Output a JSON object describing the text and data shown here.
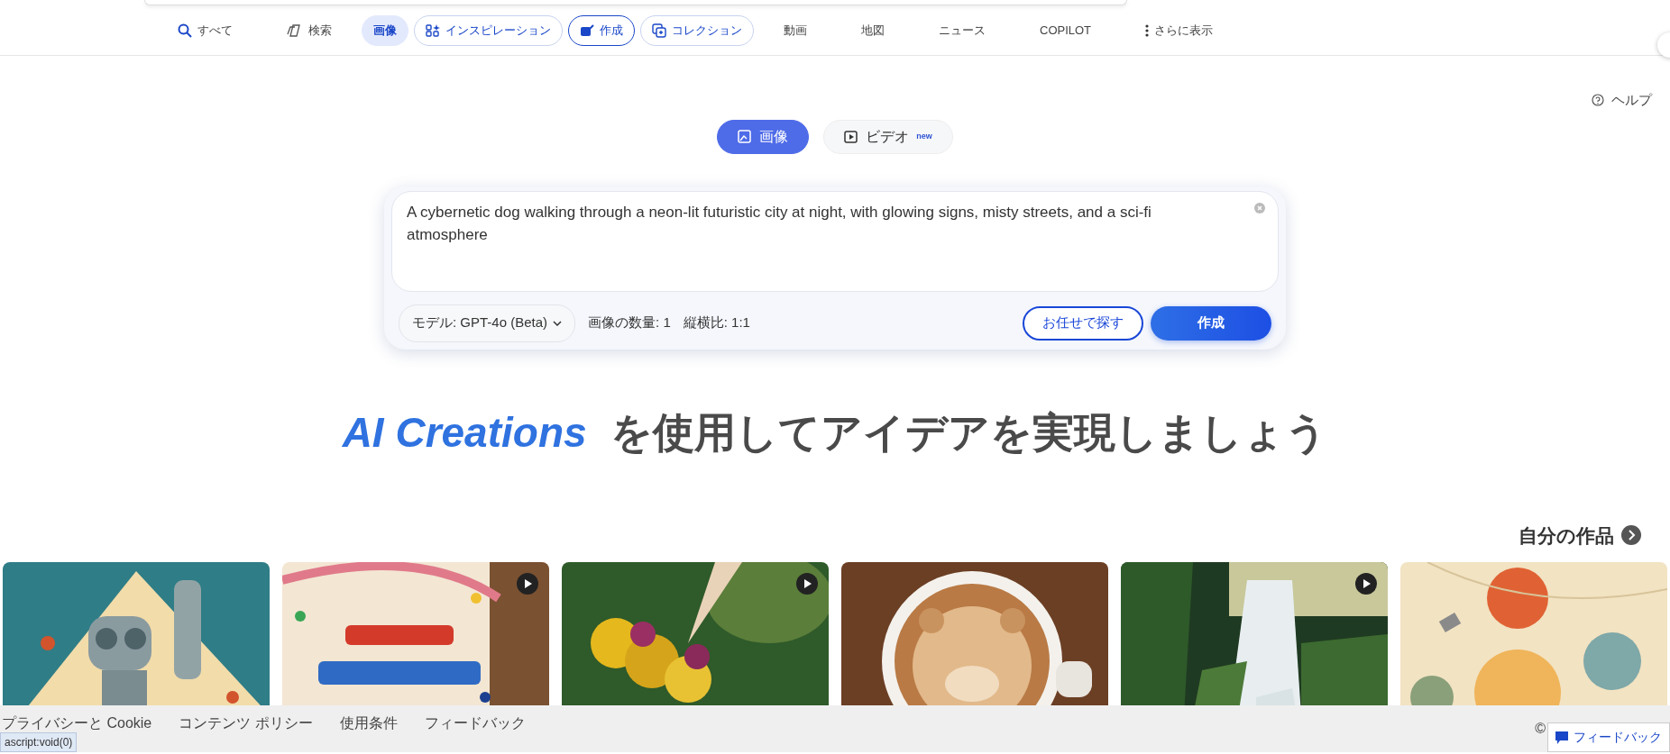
{
  "nav": {
    "tabs": [
      {
        "label": "すべて",
        "kind": "plain",
        "selected": false
      },
      {
        "label": "検索",
        "kind": "plain",
        "selected": false
      },
      {
        "label": "画像",
        "kind": "plain",
        "selected": true
      },
      {
        "label": "インスピレーション",
        "kind": "outlined",
        "selected": false
      },
      {
        "label": "作成",
        "kind": "outlined-strong",
        "selected": false
      },
      {
        "label": "コレクション",
        "kind": "outlined",
        "selected": false
      },
      {
        "label": "動画",
        "kind": "plain",
        "selected": false
      },
      {
        "label": "地図",
        "kind": "plain",
        "selected": false
      },
      {
        "label": "ニュース",
        "kind": "plain",
        "selected": false
      },
      {
        "label": "COPILOT",
        "kind": "plain",
        "selected": false
      },
      {
        "label": "さらに表示",
        "kind": "plain",
        "selected": false
      }
    ]
  },
  "help": "ヘルプ",
  "mode_toggle": [
    {
      "label": "画像",
      "selected": true
    },
    {
      "label": "ビデオ",
      "selected": false,
      "badge": "new"
    }
  ],
  "prompt": {
    "value": "A cybernetic dog walking through a neon-lit futuristic city at night, with glowing signs, misty streets, and a sci-fi atmosphere"
  },
  "options": {
    "model": "モデル: GPT-4o (Beta)",
    "count": "画像の数量: 1",
    "ratio": "縦横比: 1:1"
  },
  "buttons": {
    "surprise": "お任せで探す",
    "create": "作成"
  },
  "headline": "*AI Creations* を使用してアイデアを実現しましょう",
  "my_works": {
    "title": "自分の作品"
  },
  "gallery": [
    {
      "kind": "picture",
      "video": false
    },
    {
      "kind": "picture",
      "video": true
    },
    {
      "kind": "picture",
      "video": true
    },
    {
      "kind": "picture",
      "video": false
    },
    {
      "kind": "picture",
      "video": true
    },
    {
      "kind": "picture",
      "video": false
    }
  ],
  "footer": {
    "links": [
      "プライバシーと Cookie",
      "コンテンツ ポリシー",
      "使用条件",
      "フィードバック"
    ],
    "copyright": "©"
  },
  "status_url": "ascript:void(0)",
  "feedback_button": "フィードバック"
}
